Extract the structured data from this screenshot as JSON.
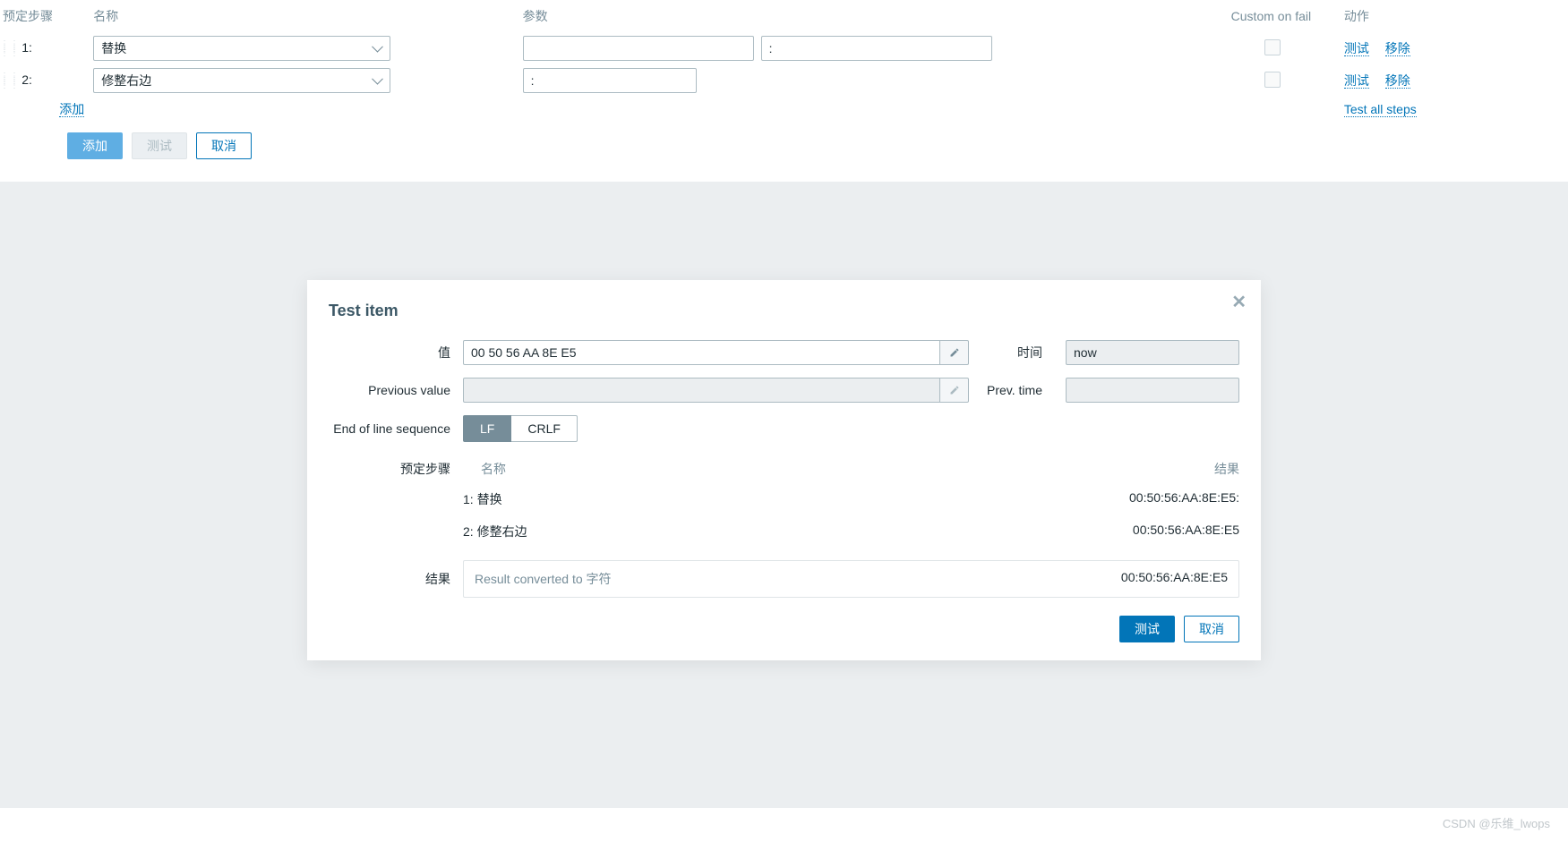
{
  "headers": {
    "steps": "预定步骤",
    "name": "名称",
    "param": "参数",
    "custom_fail": "Custom on fail",
    "actions": "动作"
  },
  "steps": [
    {
      "num": "1:",
      "name": "替换",
      "p1": "",
      "p2": ":",
      "test": "测试",
      "remove": "移除"
    },
    {
      "num": "2:",
      "name": "修整右边",
      "p1": ":",
      "test": "测试",
      "remove": "移除"
    }
  ],
  "add_link": "添加",
  "test_all": "Test all steps",
  "buttons": {
    "add": "添加",
    "test": "测试",
    "cancel": "取消"
  },
  "modal": {
    "title": "Test item",
    "value_label": "值",
    "value": "00 50 56 AA 8E E5",
    "time_label": "时间",
    "time": "now",
    "prev_value_label": "Previous value",
    "prev_value": "",
    "prev_time_label": "Prev. time",
    "prev_time": "",
    "eol_label": "End of line sequence",
    "lf": "LF",
    "crlf": "CRLF",
    "steps_label": "预定步骤",
    "step_name_header": "名称",
    "step_result_header": "结果",
    "step_rows": [
      {
        "label": "1: 替换",
        "result": "00:50:56:AA:8E:E5:"
      },
      {
        "label": "2: 修整右边",
        "result": "00:50:56:AA:8E:E5"
      }
    ],
    "result_label": "结果",
    "result_text": "Result converted to 字符",
    "result_value": "00:50:56:AA:8E:E5",
    "btn_test": "测试",
    "btn_cancel": "取消"
  },
  "watermark": "CSDN @乐维_lwops"
}
